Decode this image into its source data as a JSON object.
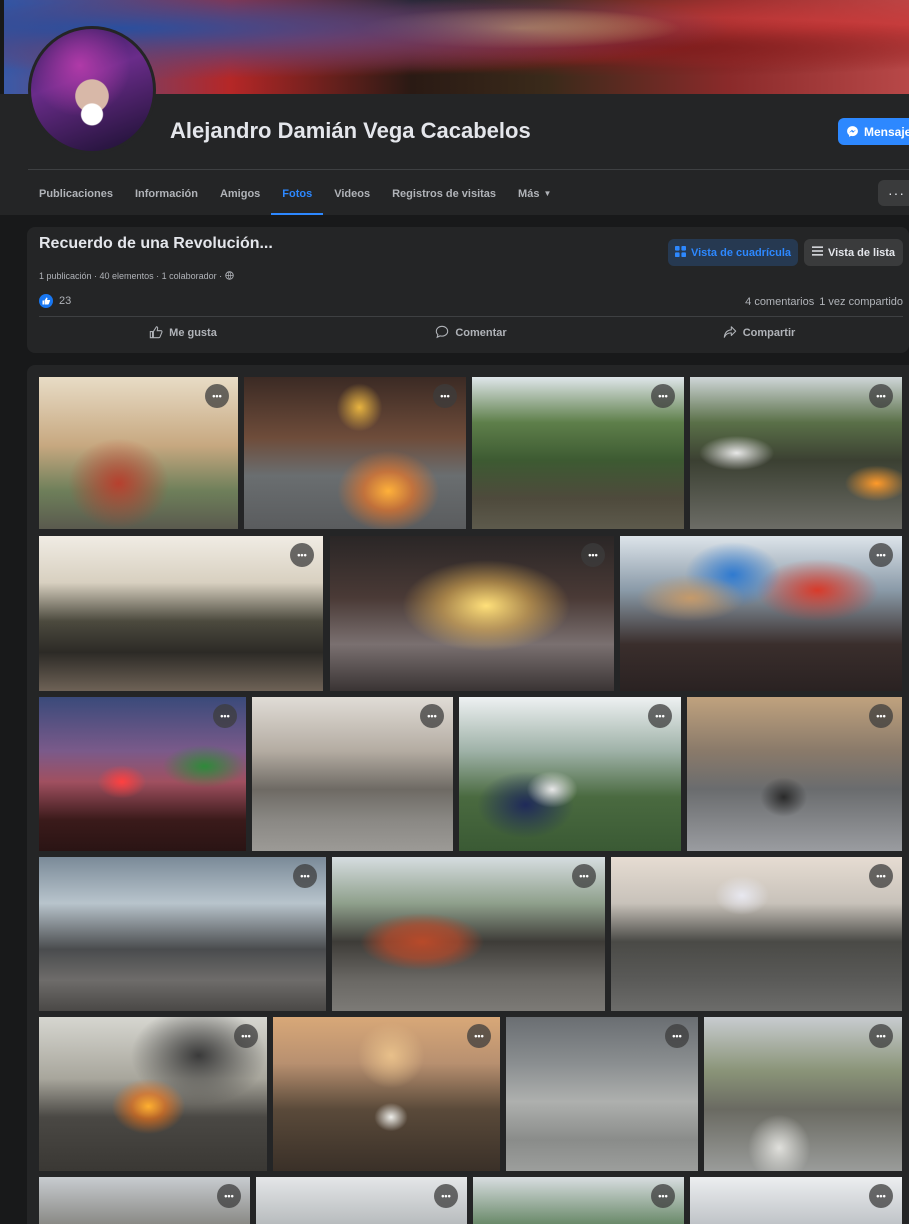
{
  "profile": {
    "name": "Alejandro Damián Vega Cacabelos",
    "message_button": "Mensaje"
  },
  "tabs": [
    {
      "label": "Publicaciones",
      "active": false
    },
    {
      "label": "Información",
      "active": false
    },
    {
      "label": "Amigos",
      "active": false
    },
    {
      "label": "Fotos",
      "active": true
    },
    {
      "label": "Videos",
      "active": false
    },
    {
      "label": "Registros de visitas",
      "active": false
    },
    {
      "label": "Más",
      "active": false
    }
  ],
  "more_options_label": "···",
  "album": {
    "title": "Recuerdo de una Revolución...",
    "meta": "1 publicación · 40 elementos · 1 colaborador ·",
    "view_grid_label": "Vista de cuadrícula",
    "view_list_label": "Vista de lista",
    "reaction_count": "23",
    "comments": "4 comentarios",
    "shares": "1 vez compartido",
    "actions": {
      "like": "Me gusta",
      "comment": "Comentar",
      "share": "Compartir"
    }
  },
  "photo_more_label": "•••",
  "colors": {
    "accent": "#2d88ff",
    "background": "#18191a",
    "surface": "#242526"
  }
}
